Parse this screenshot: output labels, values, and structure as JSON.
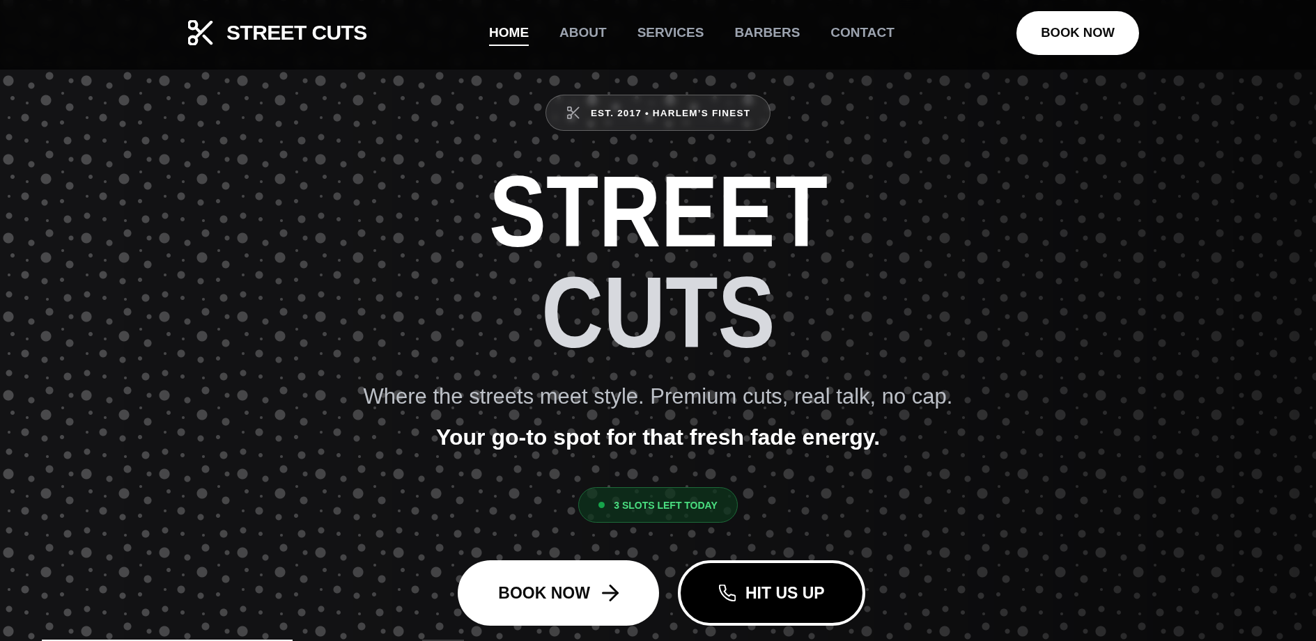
{
  "logo": {
    "text": "STREET CUTS"
  },
  "nav": {
    "links": [
      {
        "label": "HOME",
        "selected": true
      },
      {
        "label": "ABOUT",
        "selected": false
      },
      {
        "label": "SERVICES",
        "selected": false
      },
      {
        "label": "BARBERS",
        "selected": false
      },
      {
        "label": "CONTACT",
        "selected": false
      }
    ]
  },
  "header_button": {
    "label": "BOOK NOW"
  },
  "hero": {
    "badge": "EST. 2017 • HARLEM’S FINEST",
    "title_lines": [
      "STREET",
      "CUTS"
    ],
    "tagline": "Where the streets meet style. Premium cuts, real talk, no cap.",
    "subtagline": "Your go-to spot for that fresh fade energy.",
    "availability": "3 SLOTS LEFT TODAY",
    "buttons": [
      {
        "label": "BOOK NOW",
        "kind": "primary"
      },
      {
        "label": "HIT US UP",
        "kind": "secondary"
      }
    ]
  }
}
